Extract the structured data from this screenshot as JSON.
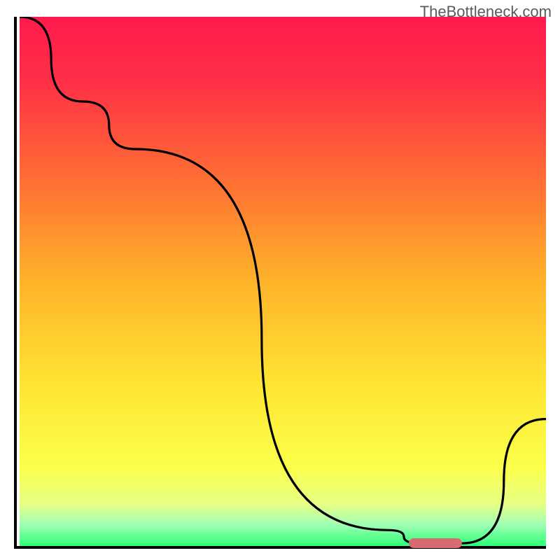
{
  "watermark": "TheBottleneck.com",
  "chart_data": {
    "type": "line",
    "title": "",
    "xlabel": "",
    "ylabel": "",
    "xlim": [
      0,
      100
    ],
    "ylim": [
      0,
      100
    ],
    "grid": false,
    "legend": false,
    "gradient_stops": [
      {
        "pos": 0.0,
        "color": "#ff1a4d"
      },
      {
        "pos": 0.12,
        "color": "#ff2f47"
      },
      {
        "pos": 0.3,
        "color": "#ff6b34"
      },
      {
        "pos": 0.5,
        "color": "#ffb32a"
      },
      {
        "pos": 0.7,
        "color": "#ffe633"
      },
      {
        "pos": 0.85,
        "color": "#fbff4a"
      },
      {
        "pos": 0.92,
        "color": "#e8ff85"
      },
      {
        "pos": 0.96,
        "color": "#9fffb4"
      },
      {
        "pos": 1.0,
        "color": "#2dff76"
      }
    ],
    "series": [
      {
        "name": "bottleneck-curve",
        "x": [
          0,
          12,
          22,
          70,
          76,
          84,
          100
        ],
        "y": [
          100,
          84,
          75,
          3,
          0.5,
          0.5,
          24
        ]
      }
    ],
    "marker": {
      "name": "optimal-range",
      "x_start": 74,
      "x_end": 84,
      "y": 0.5,
      "color": "#d86b72"
    }
  }
}
